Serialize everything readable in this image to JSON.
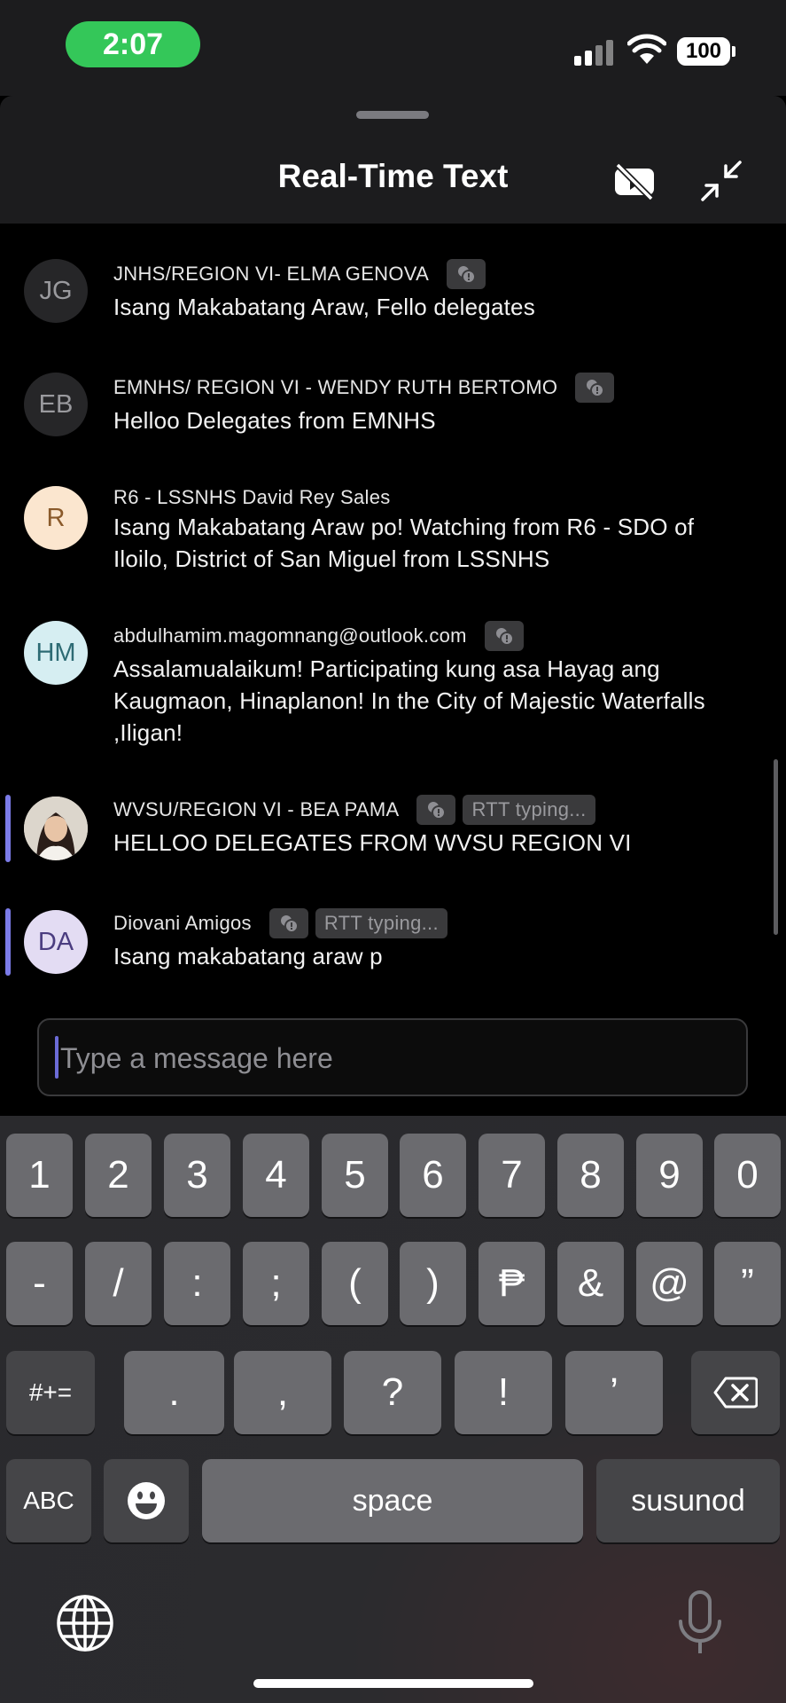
{
  "status_bar": {
    "time": "2:07",
    "battery": "100"
  },
  "header": {
    "title": "Real-Time Text",
    "video_off_icon": "video-off-icon",
    "minimize_icon": "minimize-icon"
  },
  "messages": [
    {
      "initials": "JG",
      "sender": "JNHS/REGION VI- ELMA GENOVA",
      "text": "Isang Makabatang Araw, Fello delegates",
      "avatar_bg": "#262628",
      "avatar_fg": "#9a9a9e",
      "locked": true
    },
    {
      "initials": "EB",
      "sender": "EMNHS/ REGION VI - WENDY RUTH BERTOMO",
      "text": "Helloo Delegates from EMNHS",
      "avatar_bg": "#262628",
      "avatar_fg": "#9a9a9e",
      "locked": true
    },
    {
      "initials": "R",
      "sender": "R6 - LSSNHS David Rey Sales",
      "text": "Isang Makabatang Araw po! Watching from R6 - SDO of Iloilo, District of San Miguel from LSSNHS",
      "avatar_bg": "#fbe6cf",
      "avatar_fg": "#8a5a2b",
      "locked": false
    },
    {
      "initials": "HM",
      "sender": "abdulhamim.magomnang@outlook.com",
      "text": "Assalamualaikum! Participating kung asa Hayag ang Kaugmaon, Hinaplanon! In the City of Majestic Waterfalls ,Iligan!",
      "avatar_bg": "#d6eef2",
      "avatar_fg": "#2d6b74",
      "locked": true
    },
    {
      "initials": "",
      "sender": "WVSU/REGION VI - BEA PAMA",
      "text": "HELLOO DELEGATES FROM WVSU REGION VI",
      "typing_label": "RTT typing...",
      "locked": true,
      "photo": true
    },
    {
      "initials": "DA",
      "sender": "Diovani Amigos",
      "text": "Isang makabatang araw p",
      "typing_label": "RTT typing...",
      "avatar_bg": "#e3dcf3",
      "avatar_fg": "#4b3d80",
      "locked": true
    }
  ],
  "input": {
    "placeholder": "Type a message here"
  },
  "keyboard": {
    "row1": [
      "1",
      "2",
      "3",
      "4",
      "5",
      "6",
      "7",
      "8",
      "9",
      "0"
    ],
    "row2": [
      "-",
      "/",
      ":",
      ";",
      "(",
      ")",
      "₱",
      "&",
      "@",
      "”"
    ],
    "row3": [
      "#+=",
      ".",
      ",",
      "?",
      "!",
      "’"
    ],
    "space": "space",
    "abc": "ABC",
    "return": "susunod"
  },
  "colors": {
    "accent": "#7b7be8",
    "status_green": "#34c759"
  }
}
